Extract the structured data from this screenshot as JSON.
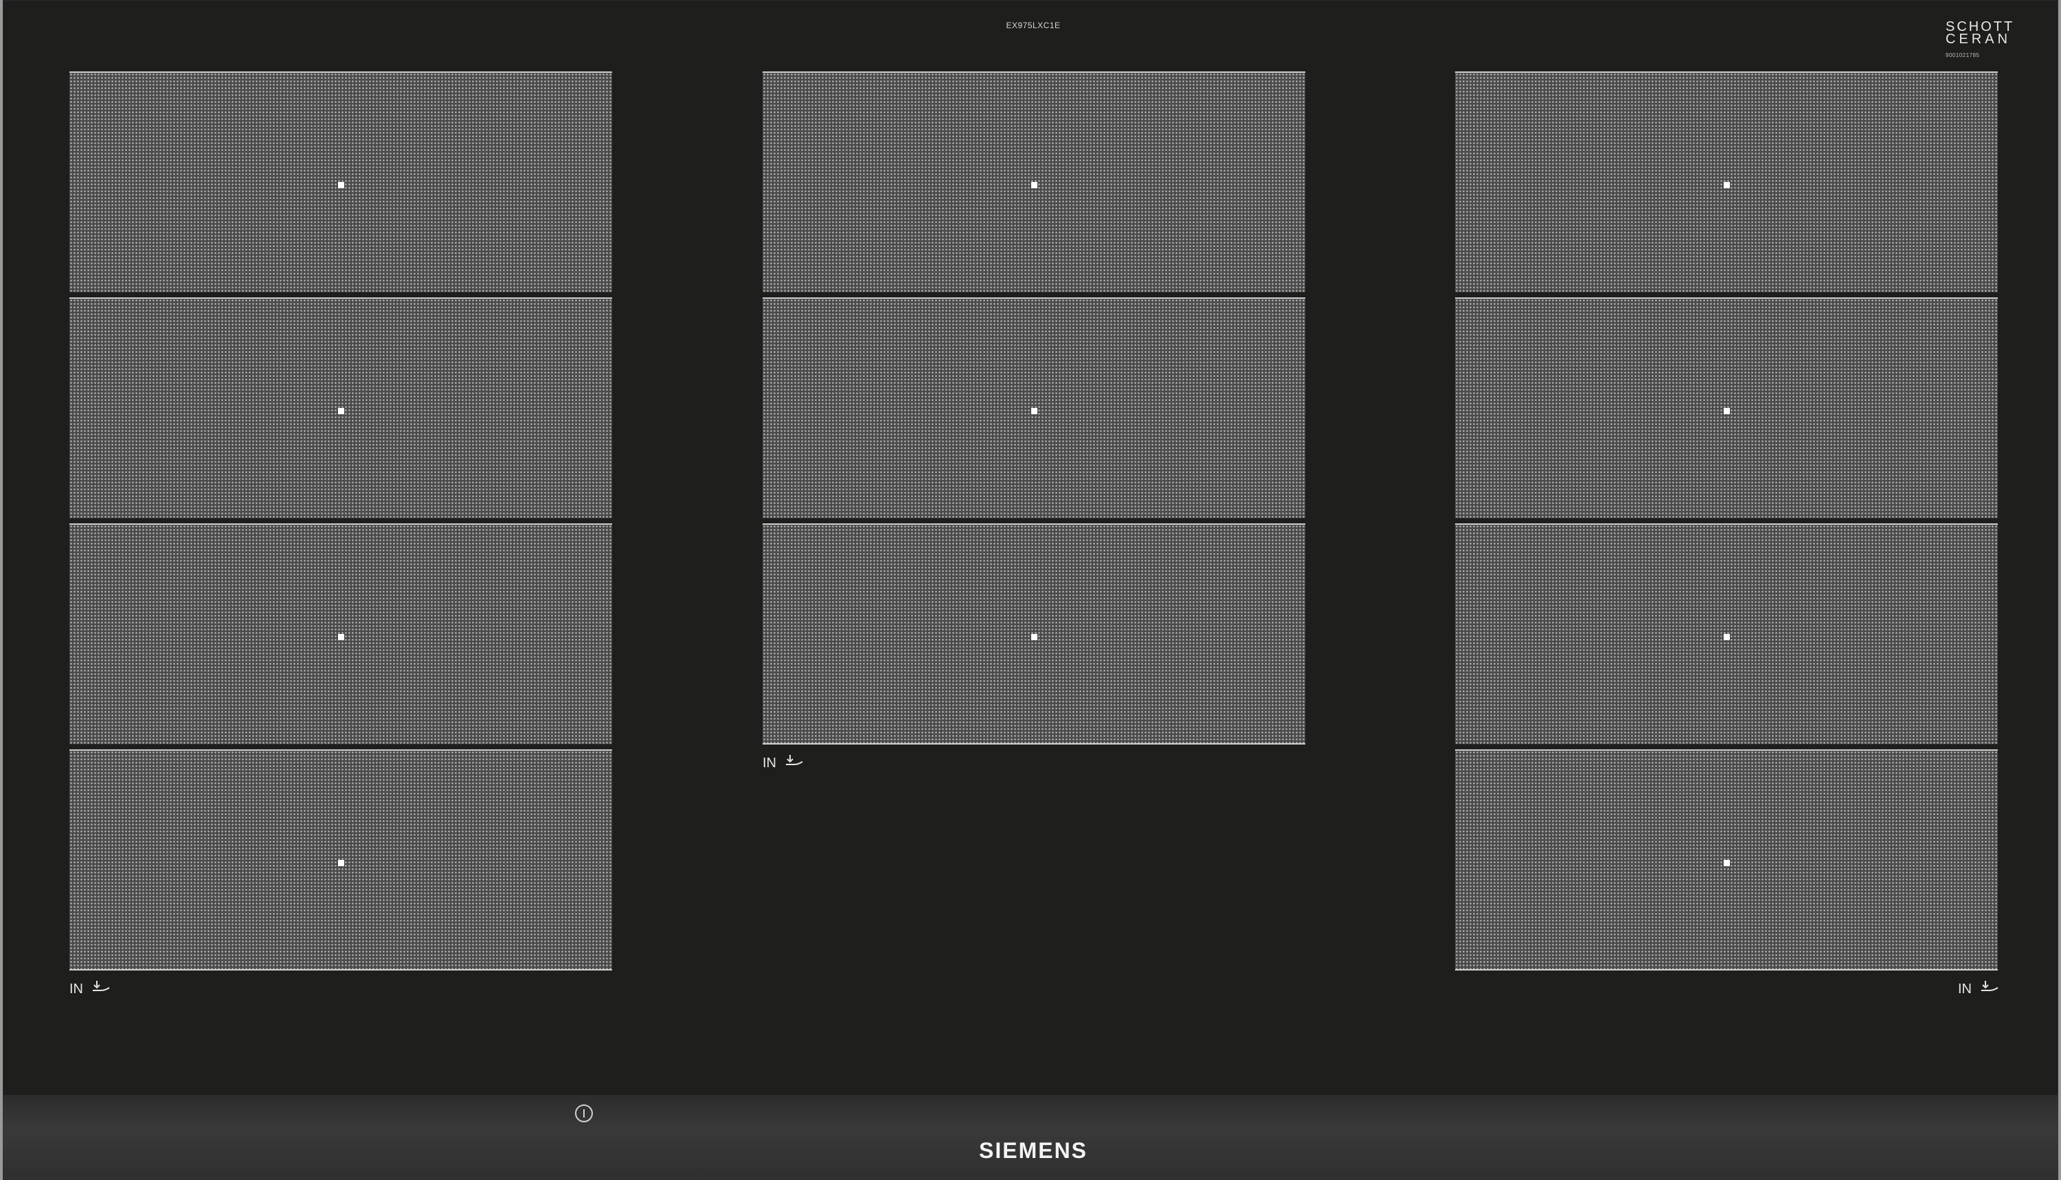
{
  "hob": {
    "model": "EX975LXC1E",
    "glass_brand": {
      "line1": "SCHOTT",
      "line2": "CERAN",
      "code": "9001021785"
    },
    "brand": "SIEMENS",
    "flex_label": "IN",
    "columns": [
      {
        "name": "left",
        "zones": 4
      },
      {
        "name": "center",
        "zones": 3
      },
      {
        "name": "right",
        "zones": 4
      }
    ],
    "icons": {
      "flex": "induction-pan-icon",
      "power": "power-icon"
    },
    "colors": {
      "glass": "#1e1e1d",
      "zone_dots": "#b4b4b4",
      "strip": "#393939"
    }
  }
}
